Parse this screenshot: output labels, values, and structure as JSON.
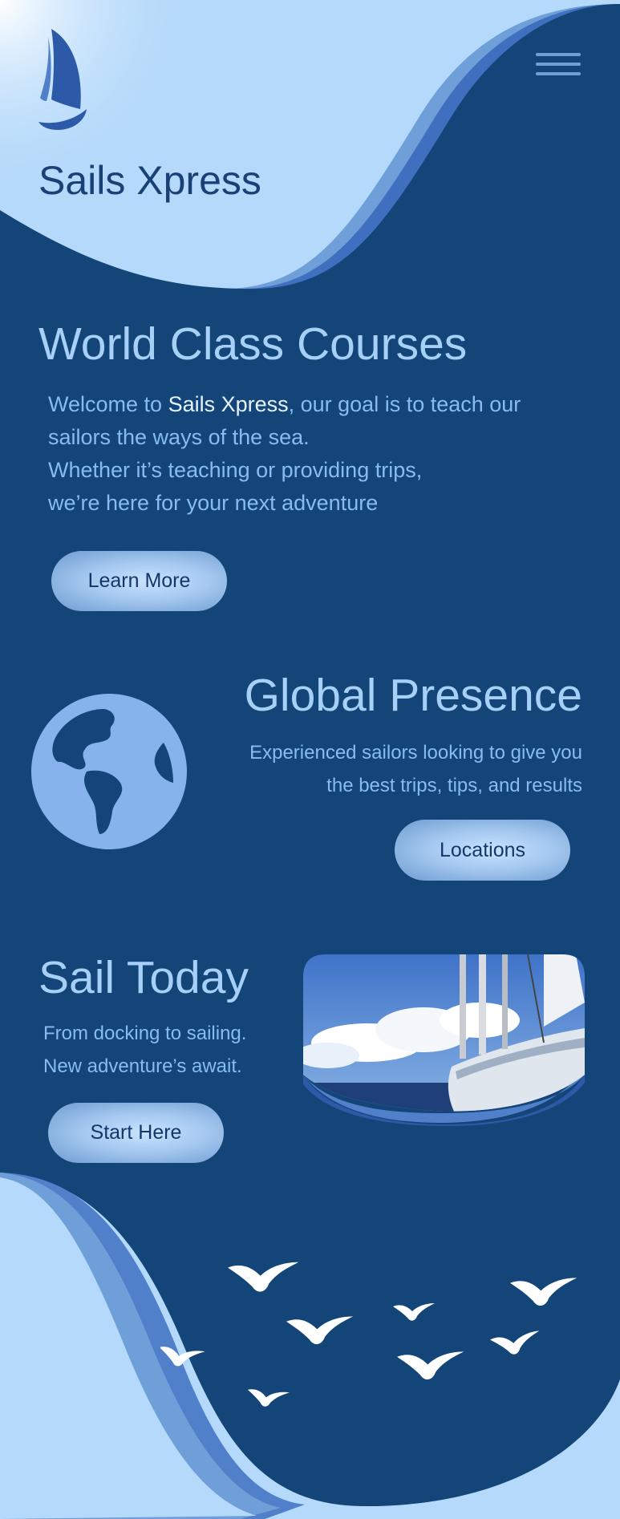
{
  "colors": {
    "light_blue": "#b4d9fb",
    "navy": "#134578",
    "accent_blue": "#4f80c9",
    "text_blue": "#86bdf1",
    "heading_blue": "#a6d0f7"
  },
  "header": {
    "brand": "Sails Xpress",
    "logo_icon": "sailboat-icon",
    "menu_icon": "hamburger-menu-icon"
  },
  "courses": {
    "title": "World Class Courses",
    "intro_prefix": "Welcome to ",
    "intro_brand": "Sails Xpress",
    "intro_suffix": ", our goal is to teach our",
    "line2": "sailors the ways of the sea.",
    "line3": "Whether it’s teaching or providing trips,",
    "line4": "we’re here for your next adventure",
    "button": "Learn More"
  },
  "presence": {
    "title": "Global Presence",
    "line1": "Experienced sailors looking to give you",
    "line2": "the best trips, tips, and results",
    "button": "Locations",
    "icon": "globe-icon"
  },
  "today": {
    "title": "Sail Today",
    "line1": "From docking to sailing.",
    "line2": "New adventure’s await.",
    "button": "Start Here",
    "image": "sailboat-photo"
  },
  "footer": {
    "decoration": "seagulls-illustration"
  }
}
